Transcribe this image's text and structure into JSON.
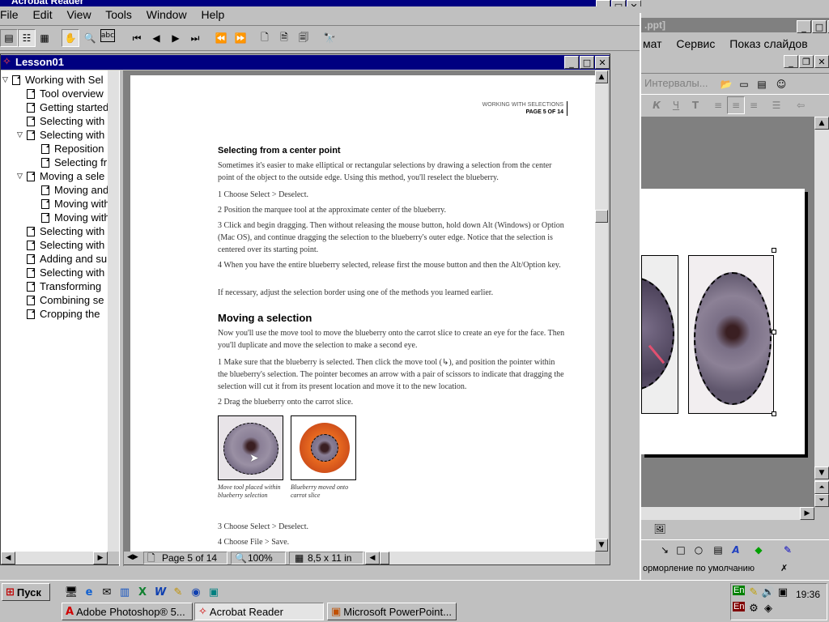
{
  "acrobat": {
    "title": "Acrobat Reader",
    "menu": [
      "File",
      "Edit",
      "View",
      "Tools",
      "Window",
      "Help"
    ],
    "doc_window_title": "Lesson01",
    "bookmarks": [
      {
        "label": "Working with Sel",
        "level": 0,
        "expanded": true
      },
      {
        "label": "Tool overview",
        "level": 1
      },
      {
        "label": "Getting started",
        "level": 1
      },
      {
        "label": "Selecting with",
        "level": 1
      },
      {
        "label": "Selecting with",
        "level": 1,
        "expanded": true
      },
      {
        "label": "Reposition",
        "level": 2
      },
      {
        "label": "Selecting fr",
        "level": 2
      },
      {
        "label": "Moving a sele",
        "level": 1,
        "expanded": true
      },
      {
        "label": "Moving and",
        "level": 2
      },
      {
        "label": "Moving with",
        "level": 2
      },
      {
        "label": "Moving with",
        "level": 2
      },
      {
        "label": "Selecting with",
        "level": 1
      },
      {
        "label": "Selecting with",
        "level": 1
      },
      {
        "label": "Adding and su",
        "level": 1
      },
      {
        "label": "Selecting with",
        "level": 1
      },
      {
        "label": "Transforming",
        "level": 1
      },
      {
        "label": "Combining se",
        "level": 1
      },
      {
        "label": "Cropping the",
        "level": 1
      }
    ],
    "status": {
      "page": "Page 5 of 14",
      "zoom": "100%",
      "paper": "8,5 x 11 in"
    }
  },
  "document": {
    "header_line1": "WORKING WITH SELECTIONS",
    "header_line2": "PAGE 5 OF 14",
    "h1": "Selecting from a center point",
    "p1": "Sometimes it's easier to make elliptical or rectangular selections by drawing a selection from the center point of the object to the outside edge. Using this method, you'll reselect the blueberry.",
    "s1": "1  Choose Select > Deselect.",
    "s2": "2  Position the marquee tool at the approximate center of the blueberry.",
    "s3": "3  Click and begin dragging. Then without releasing the mouse button, hold down Alt (Windows) or Option (Mac OS), and continue dragging the selection to the blueberry's outer edge. Notice that the selection is centered over its starting point.",
    "s4": "4  When you have the entire blueberry selected, release first the mouse button and then the Alt/Option key.",
    "p2": "If necessary, adjust the selection border using one of the methods you learned earlier.",
    "h2": "Moving a selection",
    "p3": "Now you'll use the move tool to move the blueberry onto the carrot slice to create an eye for the face. Then you'll duplicate and move the selection to make a second eye.",
    "m1": "1  Make sure that the blueberry is selected. Then click the move tool (↳), and position the pointer within the blueberry's selection. The pointer becomes an arrow with a pair of scissors to indicate that dragging the selection will cut it from its present location and move it to the new location.",
    "m2": "2  Drag the blueberry onto the carrot slice.",
    "cap1": "Move tool placed within blueberry selection",
    "cap2": "Blueberry moved onto carrot slice",
    "m3": "3  Choose Select > Deselect.",
    "m4": "4  Choose File > Save."
  },
  "powerpoint": {
    "title_fragment": ".ppt]",
    "menu": [
      "мат",
      "Сервис",
      "Показ слайдов"
    ],
    "intervals": "Интервалы...",
    "format_buttons": [
      "К",
      "Ч",
      "Т"
    ],
    "status": "орморление по умолчанию"
  },
  "taskbar": {
    "start": "Пуск",
    "tasks": [
      "Adobe Photoshop® 5...",
      "Acrobat Reader",
      "Microsoft PowerPoint..."
    ],
    "tray_lang_top": "En",
    "tray_lang_bottom": "En",
    "clock": "19:36"
  },
  "colors": {
    "title_active": "#000080",
    "face": "#c0c0c0",
    "desktop": "#008080"
  }
}
